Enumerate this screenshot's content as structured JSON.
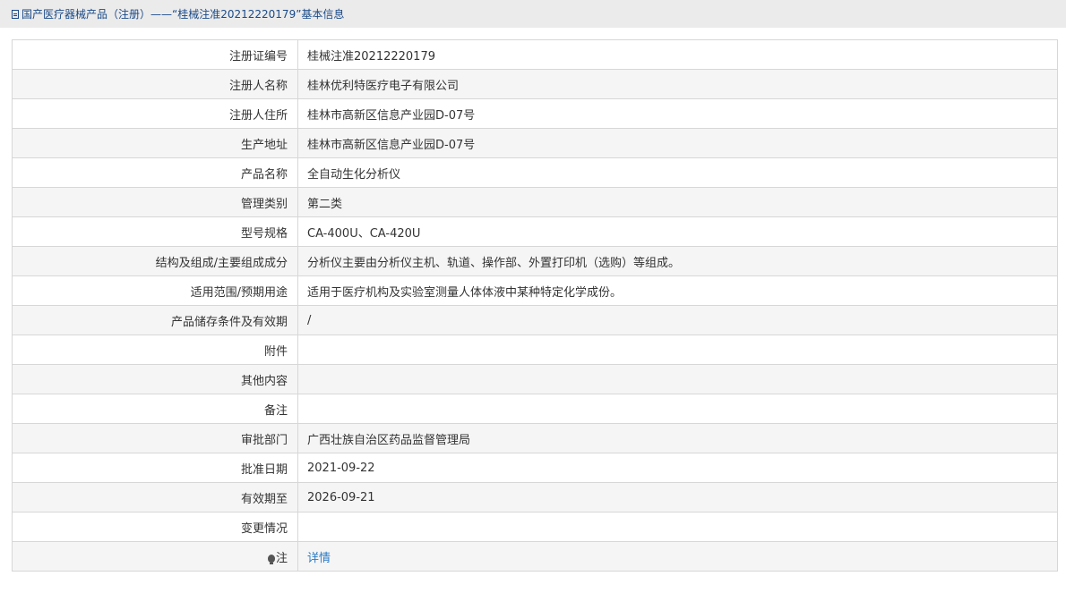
{
  "breadcrumb": {
    "icon": "document-icon",
    "text": "国产医疗器械产品（注册）——“桂械注准20212220179”基本信息"
  },
  "rows": [
    {
      "label": "注册证编号",
      "value": "桂械注准20212220179"
    },
    {
      "label": "注册人名称",
      "value": "桂林优利特医疗电子有限公司"
    },
    {
      "label": "注册人住所",
      "value": "桂林市高新区信息产业园D-07号"
    },
    {
      "label": "生产地址",
      "value": "桂林市高新区信息产业园D-07号"
    },
    {
      "label": "产品名称",
      "value": "全自动生化分析仪"
    },
    {
      "label": "管理类别",
      "value": "第二类"
    },
    {
      "label": "型号规格",
      "value": "CA-400U、CA-420U"
    },
    {
      "label": "结构及组成/主要组成成分",
      "value": "分析仪主要由分析仪主机、轨道、操作部、外置打印机（选购）等组成。"
    },
    {
      "label": "适用范围/预期用途",
      "value": "适用于医疗机构及实验室测量人体体液中某种特定化学成份。"
    },
    {
      "label": "产品储存条件及有效期",
      "value": "/"
    },
    {
      "label": "附件",
      "value": ""
    },
    {
      "label": "其他内容",
      "value": ""
    },
    {
      "label": "备注",
      "value": ""
    },
    {
      "label": "审批部门",
      "value": "广西壮族自治区药品监督管理局"
    },
    {
      "label": "批准日期",
      "value": "2021-09-22"
    },
    {
      "label": "有效期至",
      "value": "2026-09-21"
    },
    {
      "label": "变更情况",
      "value": ""
    }
  ],
  "note_row": {
    "icon": "bulb-icon",
    "label": "注",
    "link_text": "详情"
  }
}
